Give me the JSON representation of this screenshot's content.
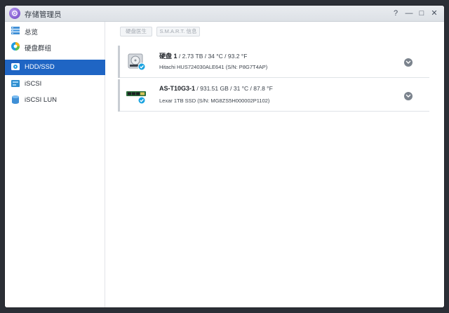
{
  "window": {
    "title": "存储管理员"
  },
  "window_controls": {
    "help": "?",
    "minimize": "—",
    "maximize": "□",
    "close": "✕"
  },
  "sidebar": {
    "items": [
      {
        "label": "总览",
        "icon": "overview-icon"
      },
      {
        "label": "硬盘群组",
        "icon": "disk-group-icon"
      },
      {
        "label": "HDD/SSD",
        "icon": "hdd-icon",
        "active": true
      },
      {
        "label": "iSCSI",
        "icon": "iscsi-icon"
      },
      {
        "label": "iSCSI LUN",
        "icon": "iscsi-lun-icon"
      }
    ]
  },
  "toolbar": {
    "health_label": "硬盘医生",
    "smart_label": "S.M.A.R.T. 信息"
  },
  "disks": [
    {
      "name": "硬盘 1",
      "info": " / 2.73 TB / 34 °C / 93.2 °F",
      "model": "Hitachi HUS724030ALE641 (S/N: P8G7T4AP)",
      "type": "hdd"
    },
    {
      "name": "AS-T10G3-1",
      "info": " / 931.51 GB / 31 °C / 87.8 °F",
      "model": "Lexar 1TB SSD (S/N: MG8ZS5H000002P1102)",
      "type": "ssd"
    }
  ],
  "colors": {
    "accent": "#1f65c4",
    "healthy": "#1aa3e0"
  }
}
